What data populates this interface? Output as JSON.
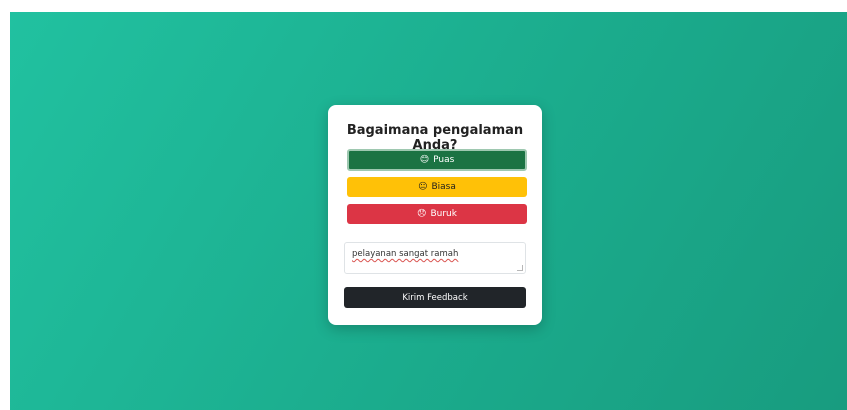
{
  "feedback": {
    "title": "Bagaimana pengalaman Anda?",
    "options": [
      {
        "label": "Puas",
        "emoji": "😊",
        "icon": "smile-face-icon",
        "color": "#1b7343",
        "selected": true
      },
      {
        "label": "Biasa",
        "emoji": "😐",
        "icon": "neutral-face-icon",
        "color": "#ffc107",
        "selected": false
      },
      {
        "label": "Buruk",
        "emoji": "😞",
        "icon": "sad-face-icon",
        "color": "#dc3545",
        "selected": false
      }
    ],
    "comment_value": "pelayanan sangat ramah",
    "submit_label": "Kirim Feedback"
  },
  "colors": {
    "background_start": "#21c1a0",
    "background_end": "#189c7f",
    "submit_button": "#212529"
  }
}
